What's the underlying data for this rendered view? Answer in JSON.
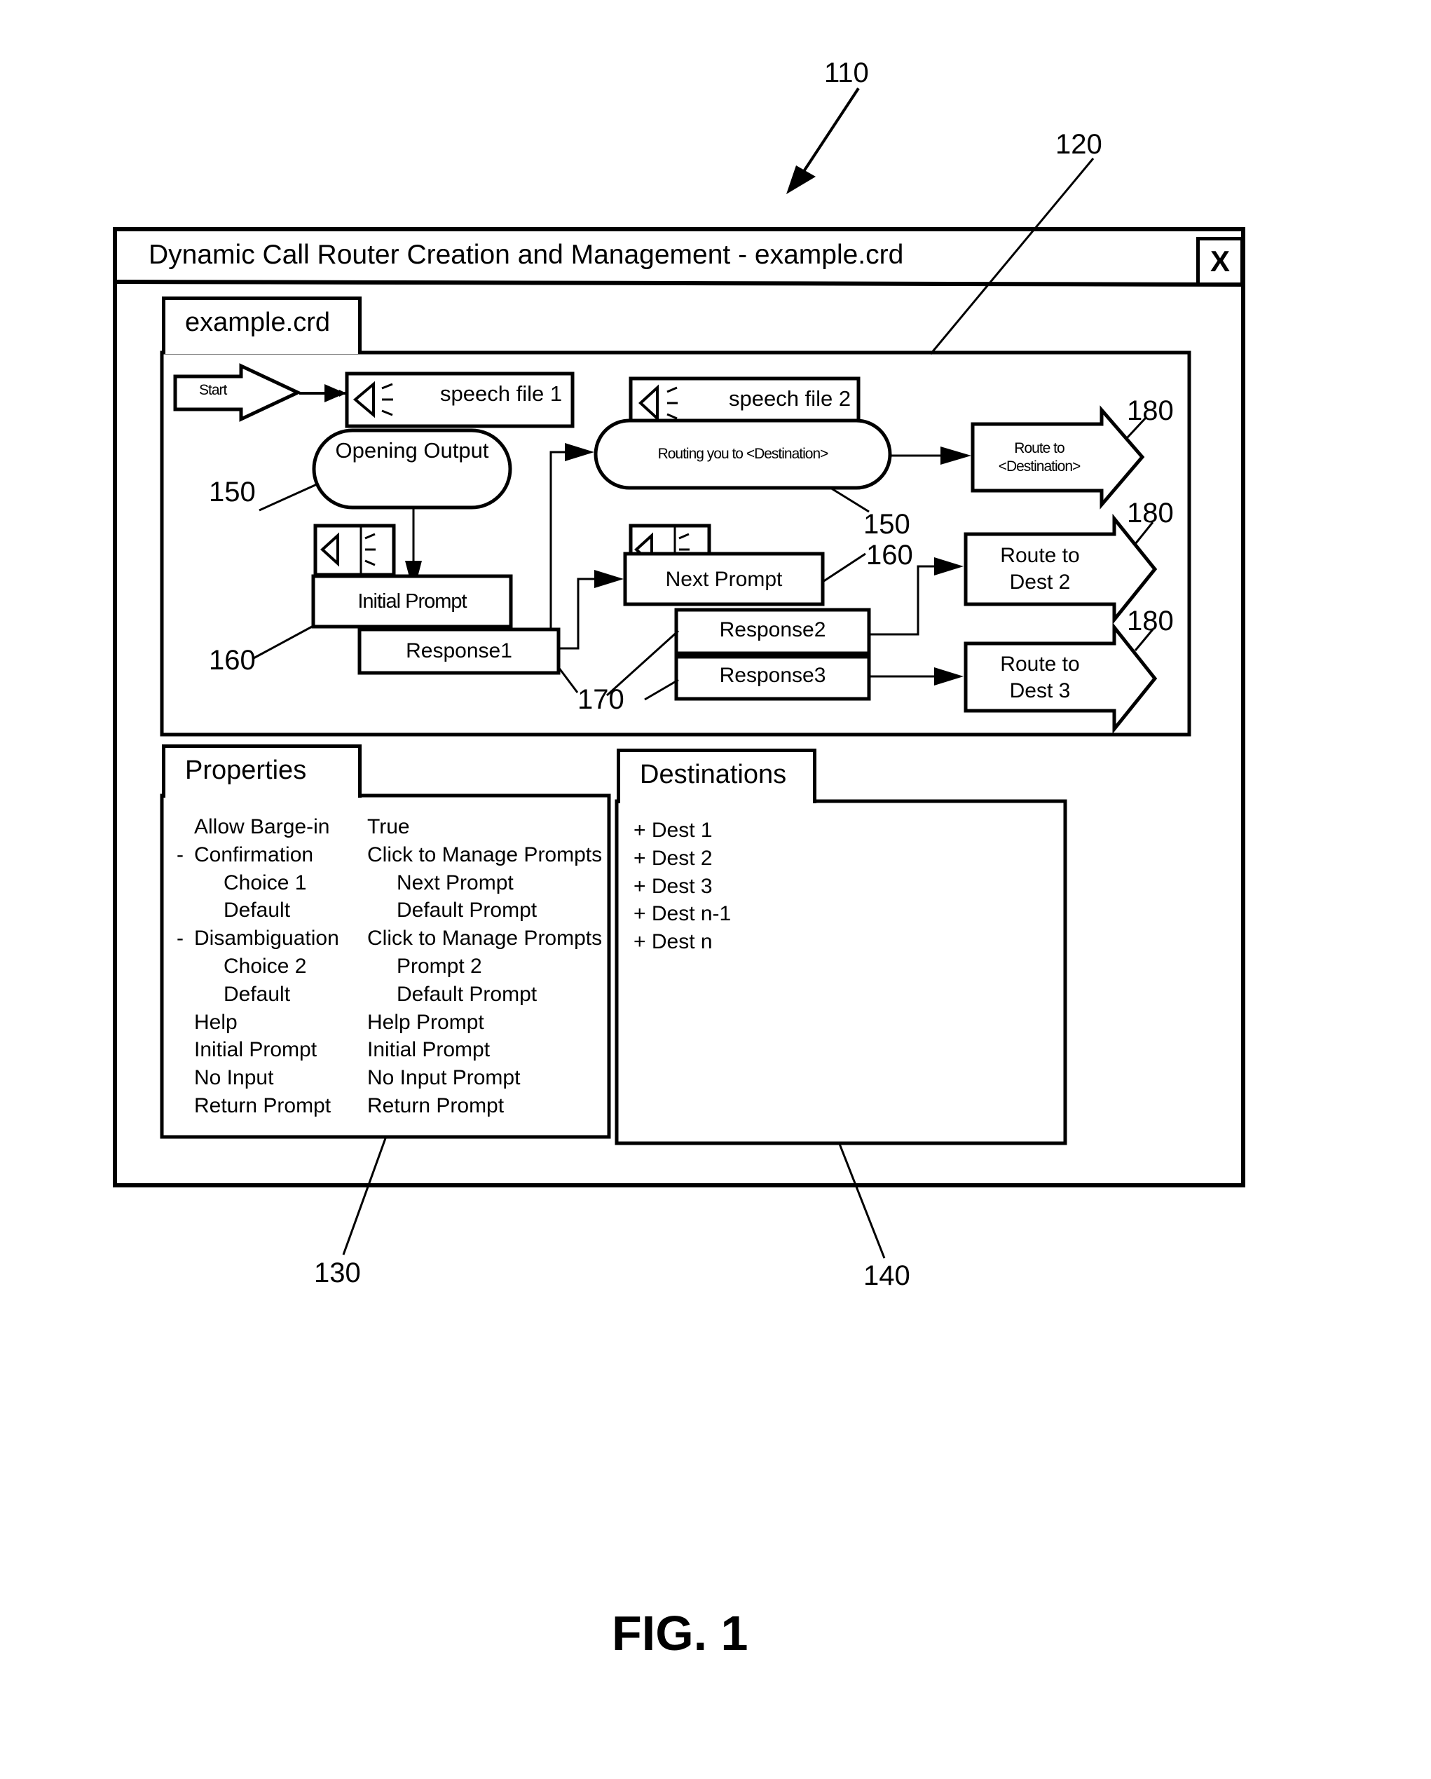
{
  "window": {
    "title": "Dynamic Call Router Creation and Management - example.crd",
    "close_label": "X"
  },
  "editor_tab": {
    "label": "example.crd"
  },
  "diagram": {
    "start": "Start",
    "speech_file_1": "speech file 1",
    "speech_file_2": "speech file 2",
    "opening_output": "Opening Output",
    "routing_output": "Routing you to <Destination>",
    "initial_prompt": "Initial Prompt",
    "response1": "Response1",
    "next_prompt": "Next Prompt",
    "response2": "Response2",
    "response3": "Response3",
    "route_destination_line1": "Route to",
    "route_destination_line2": "<Destination>",
    "route_dest2_line1": "Route to",
    "route_dest2_line2": "Dest 2",
    "route_dest3_line1": "Route to",
    "route_dest3_line2": "Dest 3"
  },
  "properties": {
    "tab_label": "Properties",
    "rows": [
      {
        "prefix": "",
        "name": "Allow Barge-in",
        "value": "True",
        "indent": false
      },
      {
        "prefix": "-",
        "name": "Confirmation",
        "value": "Click to Manage Prompts",
        "indent": false
      },
      {
        "prefix": "",
        "name": "Choice 1",
        "value": "Next Prompt",
        "indent": true
      },
      {
        "prefix": "",
        "name": "Default",
        "value": "Default Prompt",
        "indent": true
      },
      {
        "prefix": "-",
        "name": "Disambiguation",
        "value": "Click to Manage Prompts",
        "indent": false
      },
      {
        "prefix": "",
        "name": "Choice 2",
        "value": "Prompt 2",
        "indent": true
      },
      {
        "prefix": "",
        "name": "Default",
        "value": "Default Prompt",
        "indent": true
      },
      {
        "prefix": "",
        "name": "Help",
        "value": "Help Prompt",
        "indent": false
      },
      {
        "prefix": "",
        "name": "Initial Prompt",
        "value": "Initial Prompt",
        "indent": false
      },
      {
        "prefix": "",
        "name": "No Input",
        "value": "No Input Prompt",
        "indent": false
      },
      {
        "prefix": "",
        "name": "Return Prompt",
        "value": "Return Prompt",
        "indent": false
      }
    ]
  },
  "destinations": {
    "tab_label": "Destinations",
    "items": [
      "+ Dest 1",
      "+ Dest 2",
      "+ Dest 3",
      "+ Dest n-1",
      "+ Dest n"
    ]
  },
  "reference_numerals": {
    "r110": "110",
    "r120": "120",
    "r130": "130",
    "r140": "140",
    "r150": "150",
    "r160": "160",
    "r170": "170",
    "r180": "180"
  },
  "figure_label": "FIG. 1"
}
